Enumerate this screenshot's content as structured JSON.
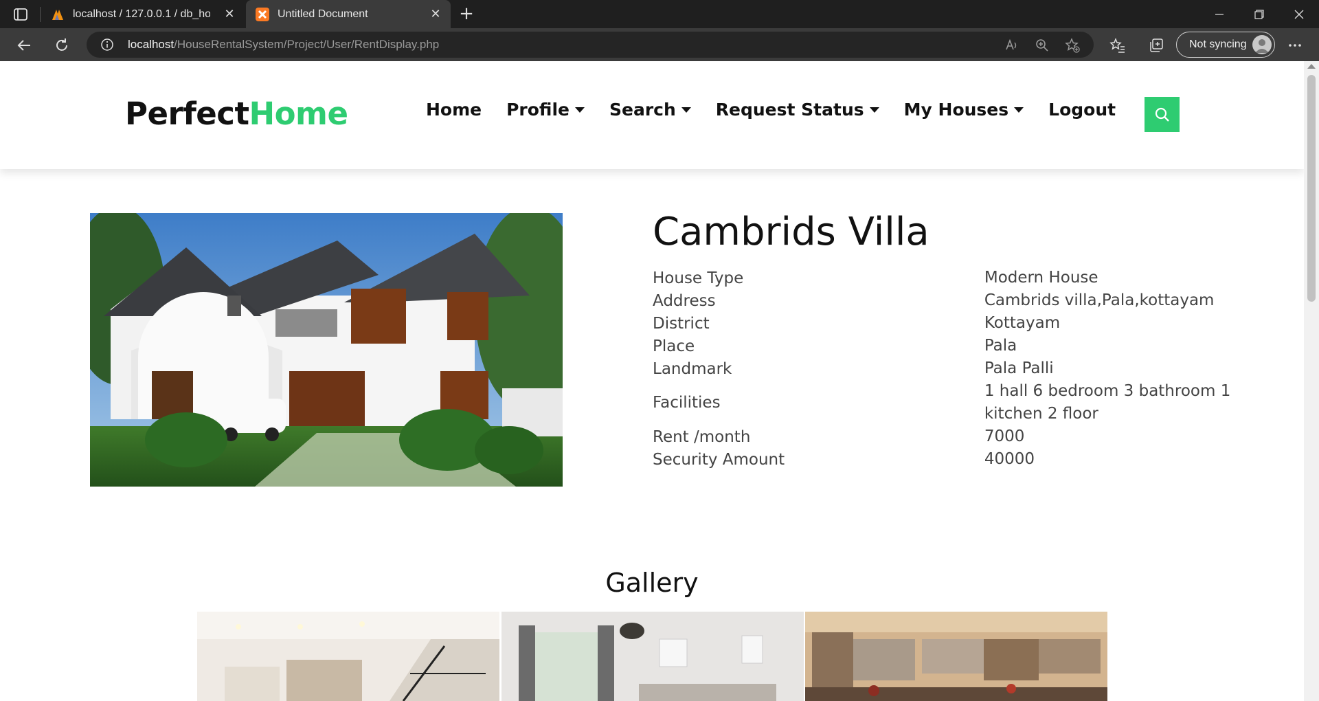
{
  "browser": {
    "tabs": [
      {
        "title": "localhost / 127.0.0.1 / db_houserent",
        "active": false,
        "icon": "phpmyadmin-icon"
      },
      {
        "title": "Untitled Document",
        "active": true,
        "icon": "xampp-icon"
      }
    ],
    "url_host": "localhost",
    "url_path": "/HouseRentalSystem/Project/User/RentDisplay.php",
    "sync_label": "Not syncing"
  },
  "site": {
    "logo_part1": "Perfect",
    "logo_part2": "Home",
    "nav": [
      {
        "label": "Home",
        "dropdown": false
      },
      {
        "label": "Profile",
        "dropdown": true
      },
      {
        "label": "Search",
        "dropdown": true
      },
      {
        "label": "Request Status",
        "dropdown": true
      },
      {
        "label": "My Houses",
        "dropdown": true
      },
      {
        "label": "Logout",
        "dropdown": false
      }
    ],
    "accent_color": "#2ecc71"
  },
  "house": {
    "name": "Cambrids Villa",
    "details": [
      {
        "label": "House Type",
        "value": "Modern House"
      },
      {
        "label": "Address",
        "value": "Cambrids villa,Pala,kottayam"
      },
      {
        "label": "District",
        "value": "Kottayam"
      },
      {
        "label": "Place",
        "value": "Pala"
      },
      {
        "label": "Landmark",
        "value": "Pala Palli"
      },
      {
        "label": "Facilities",
        "value": "1 hall 6 bedroom 3 bathroom 1 kitchen 2 floor"
      },
      {
        "label": "Rent /month",
        "value": "7000"
      },
      {
        "label": "Security Amount",
        "value": "40000"
      }
    ]
  },
  "gallery": {
    "title": "Gallery"
  }
}
